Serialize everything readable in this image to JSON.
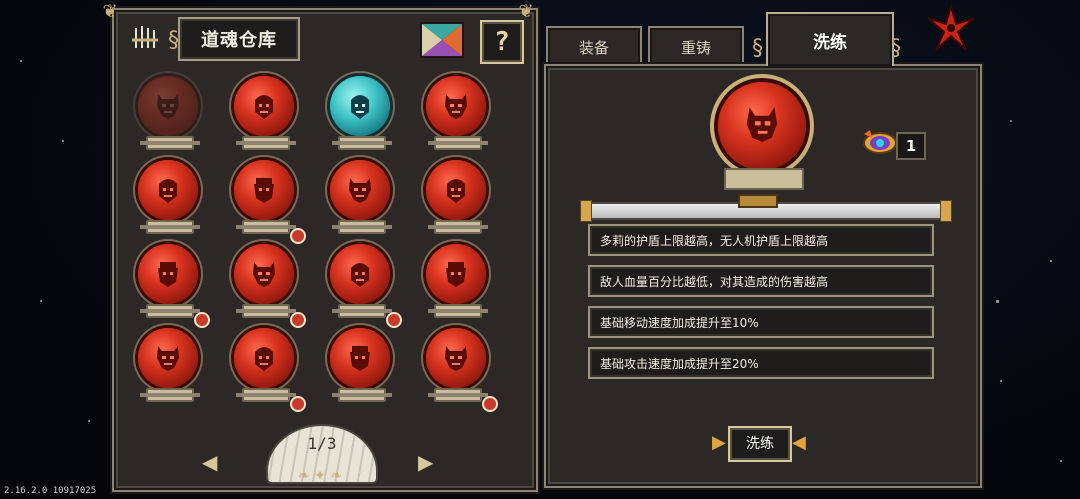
{
  "warehouse": {
    "title": "道魂仓库",
    "help_label": "?",
    "page_indicator": "1/3",
    "orbs": [
      {
        "variant": "faded",
        "badge": false
      },
      {
        "variant": "red",
        "badge": false
      },
      {
        "variant": "teal",
        "badge": false
      },
      {
        "variant": "red",
        "badge": false
      },
      {
        "variant": "red",
        "badge": false
      },
      {
        "variant": "red",
        "badge": true
      },
      {
        "variant": "red",
        "badge": false
      },
      {
        "variant": "red",
        "badge": false
      },
      {
        "variant": "red",
        "badge": true
      },
      {
        "variant": "red",
        "badge": true
      },
      {
        "variant": "red",
        "badge": true
      },
      {
        "variant": "red",
        "badge": false
      },
      {
        "variant": "red",
        "badge": false
      },
      {
        "variant": "red",
        "badge": true
      },
      {
        "variant": "red",
        "badge": false
      },
      {
        "variant": "red",
        "badge": true
      }
    ]
  },
  "tabs": {
    "equip": "装备",
    "recast": "重铸",
    "refine": "洗练"
  },
  "detail": {
    "item_count": "1",
    "attributes": [
      "多莉的护盾上限越高，无人机护盾上限越高",
      "敌人血量百分比越低，对其造成的伤害越高",
      "基础移动速度加成提升至10%",
      "基础攻击速度加成提升至20%"
    ],
    "refine_button": "洗练"
  },
  "version": "2.16.2.0 10917025",
  "colors": {
    "orb_red": "#d8341f",
    "orb_teal": "#3fc4c7",
    "panel_bg": "#2b2826",
    "frame": "#8d8574",
    "gold": "#c9b07a"
  }
}
